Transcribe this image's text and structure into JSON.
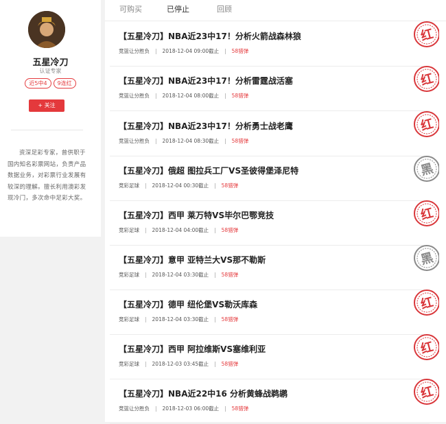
{
  "profile": {
    "name": "五星冷刀",
    "title": "认证专家",
    "badges": [
      "近5中4",
      "9连红"
    ],
    "follow_label": "+ 关注",
    "bio": "资深足彩专家，曾供职于国内知名彩票网站，负责产品数据业务，对彩票行业发展有较深的理解。擅长利用澳彩发现冷门，多次命中足彩大奖。"
  },
  "tabs": [
    {
      "label": "可购买"
    },
    {
      "label": "已停止"
    },
    {
      "label": "回顾"
    }
  ],
  "active_tab": "已停止",
  "colors": {
    "accent": "#e4393c",
    "stamp_red": "#d9363a",
    "stamp_black": "#8a8a8a"
  },
  "items": [
    {
      "title": "【五星冷刀】NBA近23中17！分析火箭战森林狼",
      "category": "竞篮让分胜负",
      "time": "2018-12-04 09:00截止",
      "price": "58猎弹",
      "stamp": "红",
      "stamp_type": "red"
    },
    {
      "title": "【五星冷刀】NBA近23中17！分析雷霆战活塞",
      "category": "竞篮让分胜负",
      "time": "2018-12-04 08:00截止",
      "price": "58猎弹",
      "stamp": "红",
      "stamp_type": "red"
    },
    {
      "title": "【五星冷刀】NBA近23中17！分析勇士战老鹰",
      "category": "竞篮让分胜负",
      "time": "2018-12-04 08:30截止",
      "price": "58猎弹",
      "stamp": "红",
      "stamp_type": "red"
    },
    {
      "title": "【五星冷刀】俄超 图拉兵工厂VS圣彼得堡泽尼特",
      "category": "竞彩足球",
      "time": "2018-12-04 00:30截止",
      "price": "58猎弹",
      "stamp": "黑",
      "stamp_type": "black"
    },
    {
      "title": "【五星冷刀】西甲 莱万特VS毕尔巴鄂竞技",
      "category": "竞彩足球",
      "time": "2018-12-04 04:00截止",
      "price": "58猎弹",
      "stamp": "红",
      "stamp_type": "red"
    },
    {
      "title": "【五星冷刀】意甲 亚特兰大VS那不勒斯",
      "category": "竞彩足球",
      "time": "2018-12-04 03:30截止",
      "price": "58猎弹",
      "stamp": "黑",
      "stamp_type": "black"
    },
    {
      "title": "【五星冷刀】德甲 纽伦堡VS勒沃库森",
      "category": "竞彩足球",
      "time": "2018-12-04 03:30截止",
      "price": "58猎弹",
      "stamp": "红",
      "stamp_type": "red"
    },
    {
      "title": "【五星冷刀】西甲 阿拉维斯VS塞维利亚",
      "category": "竞彩足球",
      "time": "2018-12-03 03:45截止",
      "price": "58猎弹",
      "stamp": "红",
      "stamp_type": "red"
    },
    {
      "title": "【五星冷刀】NBA近22中16 分析黄蜂战鹈鹕",
      "category": "竞篮让分胜负",
      "time": "2018-12-03 06:00截止",
      "price": "58猎弹",
      "stamp": "红",
      "stamp_type": "red"
    }
  ]
}
